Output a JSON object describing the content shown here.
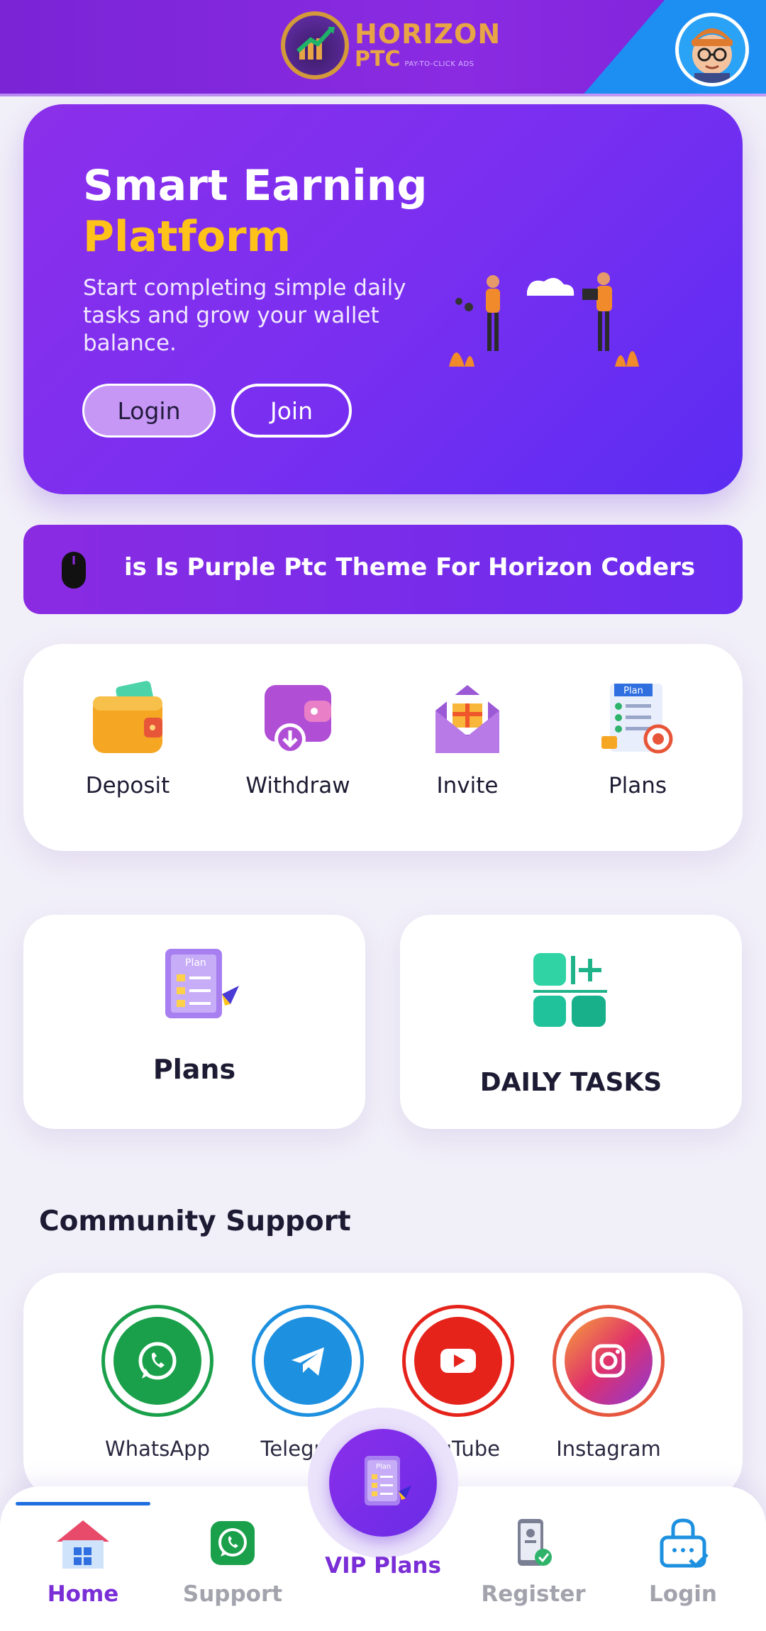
{
  "header": {
    "logo_title": "HORIZON",
    "logo_sub": "PTC",
    "logo_tagline": "PAY-TO-CLICK ADS"
  },
  "hero": {
    "title_line1": "Smart Earning",
    "title_line2": "Platform",
    "description": "Start completing simple daily tasks and grow your wallet balance.",
    "login_label": "Login",
    "join_label": "Join"
  },
  "marquee": {
    "text": "is Is Purple Ptc Theme For Horizon Coders"
  },
  "quick_actions": [
    {
      "label": "Deposit",
      "icon": "wallet-icon"
    },
    {
      "label": "Withdraw",
      "icon": "withdraw-icon"
    },
    {
      "label": "Invite",
      "icon": "gift-envelope-icon"
    },
    {
      "label": "Plans",
      "icon": "plan-target-icon"
    }
  ],
  "cards": {
    "plans_label": "Plans",
    "tasks_label": "DAILY TASKS"
  },
  "community": {
    "title": "Community Support",
    "items": [
      {
        "label": "WhatsApp",
        "icon": "whatsapp-icon",
        "color": "#1aa04a"
      },
      {
        "label": "Telegram",
        "icon": "telegram-icon",
        "color": "#1e90e0"
      },
      {
        "label": "YouTube",
        "icon": "youtube-icon",
        "color": "#e5231b"
      },
      {
        "label": "Instagram",
        "icon": "instagram-icon",
        "color": "#d62f7a"
      }
    ]
  },
  "nav": {
    "home": "Home",
    "support": "Support",
    "vip": "VIP Plans",
    "register": "Register",
    "login": "Login"
  },
  "colors": {
    "primary": "#8a2be2",
    "accent_yellow": "#ffc21a",
    "nav_active": "#7a2ed6",
    "nav_inactive": "#a3a3ad"
  }
}
